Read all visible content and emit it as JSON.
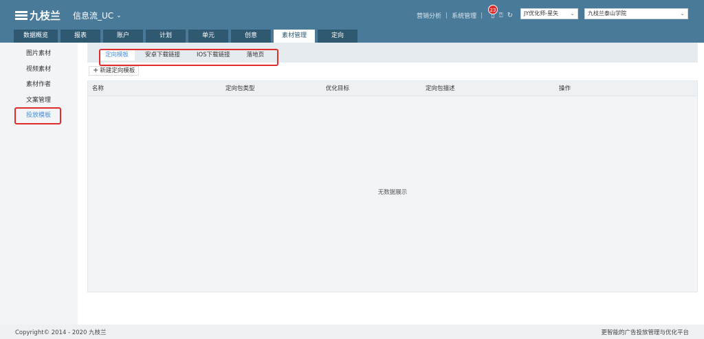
{
  "header": {
    "brand": "九枝兰",
    "product": "信息流_UC",
    "links": [
      "营销分析",
      "系统管理"
    ],
    "notification_count": "23",
    "account_select": "JY优化师-星矢",
    "school_select": "九枝兰泰山学院"
  },
  "main_tabs": [
    "数据概览",
    "报表",
    "账户",
    "计划",
    "单元",
    "创意",
    "素材管理",
    "定向"
  ],
  "sidebar": {
    "items": [
      "图片素材",
      "视频素材",
      "素材作者",
      "文案管理",
      "投放模板"
    ]
  },
  "sub_tabs": [
    "定向模板",
    "安卓下载链接",
    "IOS下载链接",
    "落地页"
  ],
  "toolbar": {
    "new_label": "新建定向模板"
  },
  "table": {
    "columns": [
      "名称",
      "定向包类型",
      "优化目标",
      "定向包描述",
      "操作"
    ],
    "empty_text": "无数据展示"
  },
  "footer": {
    "copyright": "Copyright© 2014 - 2020 九枝兰",
    "slogan": "更智能的广告投放管理与优化平台"
  },
  "colors": {
    "header": "#4a7a99",
    "tab_dark": "#2f5871",
    "accent": "#4a90d9",
    "highlight": "#e02b2b"
  }
}
